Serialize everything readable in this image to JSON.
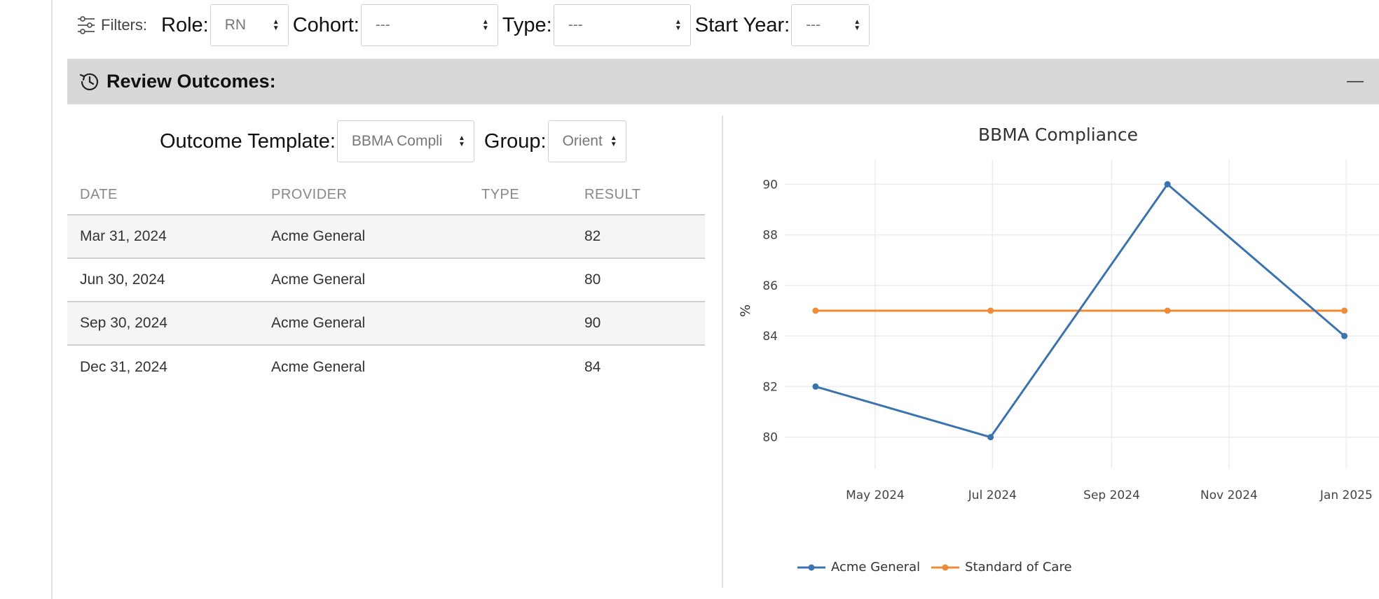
{
  "filters": {
    "label": "Filters:",
    "role": {
      "label": "Role:",
      "value": "RN"
    },
    "cohort": {
      "label": "Cohort:",
      "value": "---"
    },
    "type": {
      "label": "Type:",
      "value": "---"
    },
    "start_year": {
      "label": "Start Year:",
      "value": "---"
    }
  },
  "review": {
    "title": "Review Outcomes:",
    "collapse_symbol": "—",
    "outcome_template": {
      "label": "Outcome Template:",
      "value": "BBMA Compli"
    },
    "group": {
      "label": "Group:",
      "value": "Orient"
    }
  },
  "table": {
    "headers": [
      "DATE",
      "PROVIDER",
      "TYPE",
      "RESULT"
    ],
    "rows": [
      {
        "date": "Mar 31, 2024",
        "provider": "Acme General",
        "type": "",
        "result": "82"
      },
      {
        "date": "Jun 30, 2024",
        "provider": "Acme General",
        "type": "",
        "result": "80"
      },
      {
        "date": "Sep 30, 2024",
        "provider": "Acme General",
        "type": "",
        "result": "90"
      },
      {
        "date": "Dec 31, 2024",
        "provider": "Acme General",
        "type": "",
        "result": "84"
      }
    ]
  },
  "chart_data": {
    "type": "line",
    "title": "BBMA Compliance",
    "xlabel": "",
    "ylabel": "%",
    "x_ticks": [
      "May 2024",
      "Jul 2024",
      "Sep 2024",
      "Nov 2024",
      "Jan 2025"
    ],
    "y_ticks": [
      80,
      82,
      84,
      86,
      88,
      90
    ],
    "ylim": [
      79.3,
      90.7
    ],
    "xlim": [
      "2024-03-15",
      "2025-01-18"
    ],
    "grid": true,
    "legend_position": "bottom-left",
    "series": [
      {
        "name": "Acme General",
        "color": "#3b73af",
        "x": [
          "2024-03-31",
          "2024-06-30",
          "2024-09-30",
          "2024-12-31"
        ],
        "y": [
          82,
          80,
          90,
          84
        ]
      },
      {
        "name": "Standard of Care",
        "color": "#f08a34",
        "x": [
          "2024-03-31",
          "2024-06-30",
          "2024-09-30",
          "2024-12-31"
        ],
        "y": [
          85,
          85,
          85,
          85
        ]
      }
    ]
  }
}
